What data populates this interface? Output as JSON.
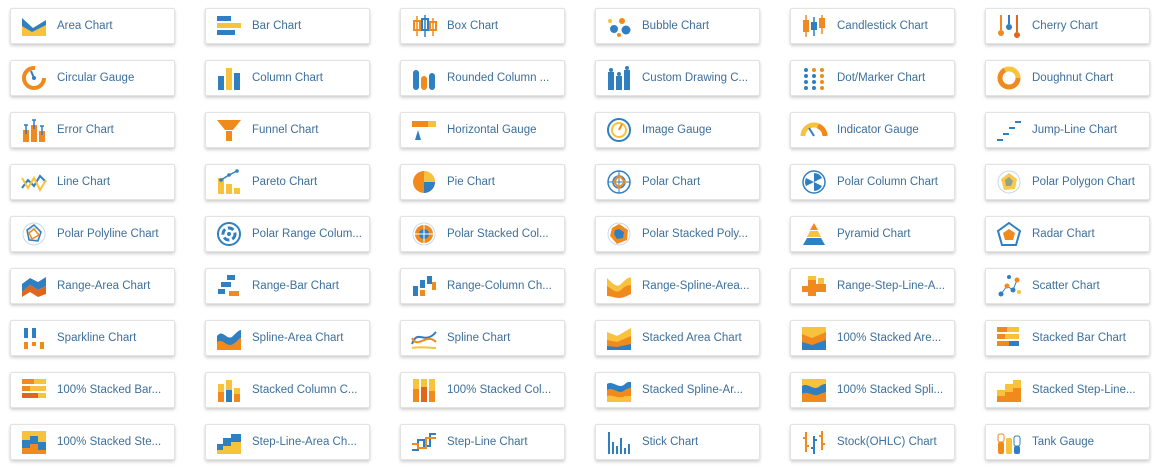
{
  "palette": {
    "blue": "#2f7fc1",
    "orange": "#f08a1d",
    "yellow": "#f9c23c",
    "darkorange": "#e0661b",
    "label": "#3d6f9b"
  },
  "cards": [
    {
      "label": "Area Chart",
      "icon": "area-chart-icon"
    },
    {
      "label": "Bar Chart",
      "icon": "bar-chart-icon"
    },
    {
      "label": "Box Chart",
      "icon": "box-chart-icon"
    },
    {
      "label": "Bubble Chart",
      "icon": "bubble-chart-icon"
    },
    {
      "label": "Candlestick Chart",
      "icon": "candlestick-chart-icon"
    },
    {
      "label": "Cherry Chart",
      "icon": "cherry-chart-icon"
    },
    {
      "label": "Circular Gauge",
      "icon": "circular-gauge-icon"
    },
    {
      "label": "Column Chart",
      "icon": "column-chart-icon"
    },
    {
      "label": "Rounded Column ...",
      "icon": "rounded-column-chart-icon"
    },
    {
      "label": "Custom Drawing C...",
      "icon": "custom-drawing-chart-icon"
    },
    {
      "label": "Dot/Marker Chart",
      "icon": "dot-marker-chart-icon"
    },
    {
      "label": "Doughnut Chart",
      "icon": "doughnut-chart-icon"
    },
    {
      "label": "Error Chart",
      "icon": "error-chart-icon"
    },
    {
      "label": "Funnel Chart",
      "icon": "funnel-chart-icon"
    },
    {
      "label": "Horizontal Gauge",
      "icon": "horizontal-gauge-icon"
    },
    {
      "label": "Image Gauge",
      "icon": "image-gauge-icon"
    },
    {
      "label": "Indicator Gauge",
      "icon": "indicator-gauge-icon"
    },
    {
      "label": "Jump-Line Chart",
      "icon": "jump-line-chart-icon"
    },
    {
      "label": "Line Chart",
      "icon": "line-chart-icon"
    },
    {
      "label": "Pareto Chart",
      "icon": "pareto-chart-icon"
    },
    {
      "label": "Pie Chart",
      "icon": "pie-chart-icon"
    },
    {
      "label": "Polar Chart",
      "icon": "polar-chart-icon"
    },
    {
      "label": "Polar Column Chart",
      "icon": "polar-column-chart-icon"
    },
    {
      "label": "Polar Polygon Chart",
      "icon": "polar-polygon-chart-icon"
    },
    {
      "label": "Polar Polyline Chart",
      "icon": "polar-polyline-chart-icon"
    },
    {
      "label": "Polar Range Colum...",
      "icon": "polar-range-column-chart-icon"
    },
    {
      "label": "Polar Stacked Col...",
      "icon": "polar-stacked-column-chart-icon"
    },
    {
      "label": "Polar Stacked Poly...",
      "icon": "polar-stacked-polygon-chart-icon"
    },
    {
      "label": "Pyramid Chart",
      "icon": "pyramid-chart-icon"
    },
    {
      "label": "Radar Chart",
      "icon": "radar-chart-icon"
    },
    {
      "label": "Range-Area Chart",
      "icon": "range-area-chart-icon"
    },
    {
      "label": "Range-Bar Chart",
      "icon": "range-bar-chart-icon"
    },
    {
      "label": "Range-Column Ch...",
      "icon": "range-column-chart-icon"
    },
    {
      "label": "Range-Spline-Area...",
      "icon": "range-spline-area-chart-icon"
    },
    {
      "label": "Range-Step-Line-A...",
      "icon": "range-step-line-area-chart-icon"
    },
    {
      "label": "Scatter Chart",
      "icon": "scatter-chart-icon"
    },
    {
      "label": "Sparkline Chart",
      "icon": "sparkline-chart-icon"
    },
    {
      "label": "Spline-Area Chart",
      "icon": "spline-area-chart-icon"
    },
    {
      "label": "Spline Chart",
      "icon": "spline-chart-icon"
    },
    {
      "label": "Stacked Area Chart",
      "icon": "stacked-area-chart-icon"
    },
    {
      "label": "100% Stacked Are...",
      "icon": "full-stacked-area-chart-icon"
    },
    {
      "label": "Stacked Bar Chart",
      "icon": "stacked-bar-chart-icon"
    },
    {
      "label": "100% Stacked Bar...",
      "icon": "full-stacked-bar-chart-icon"
    },
    {
      "label": "Stacked Column C...",
      "icon": "stacked-column-chart-icon"
    },
    {
      "label": "100% Stacked Col...",
      "icon": "full-stacked-column-chart-icon"
    },
    {
      "label": "Stacked Spline-Ar...",
      "icon": "stacked-spline-area-chart-icon"
    },
    {
      "label": "100% Stacked Spli...",
      "icon": "full-stacked-spline-area-chart-icon"
    },
    {
      "label": "Stacked Step-Line...",
      "icon": "stacked-step-line-chart-icon"
    },
    {
      "label": "100% Stacked Ste...",
      "icon": "full-stacked-step-line-chart-icon"
    },
    {
      "label": "Step-Line-Area Ch...",
      "icon": "step-line-area-chart-icon"
    },
    {
      "label": "Step-Line Chart",
      "icon": "step-line-chart-icon"
    },
    {
      "label": "Stick Chart",
      "icon": "stick-chart-icon"
    },
    {
      "label": "Stock(OHLC) Chart",
      "icon": "stock-ohlc-chart-icon"
    },
    {
      "label": "Tank Gauge",
      "icon": "tank-gauge-icon"
    }
  ]
}
